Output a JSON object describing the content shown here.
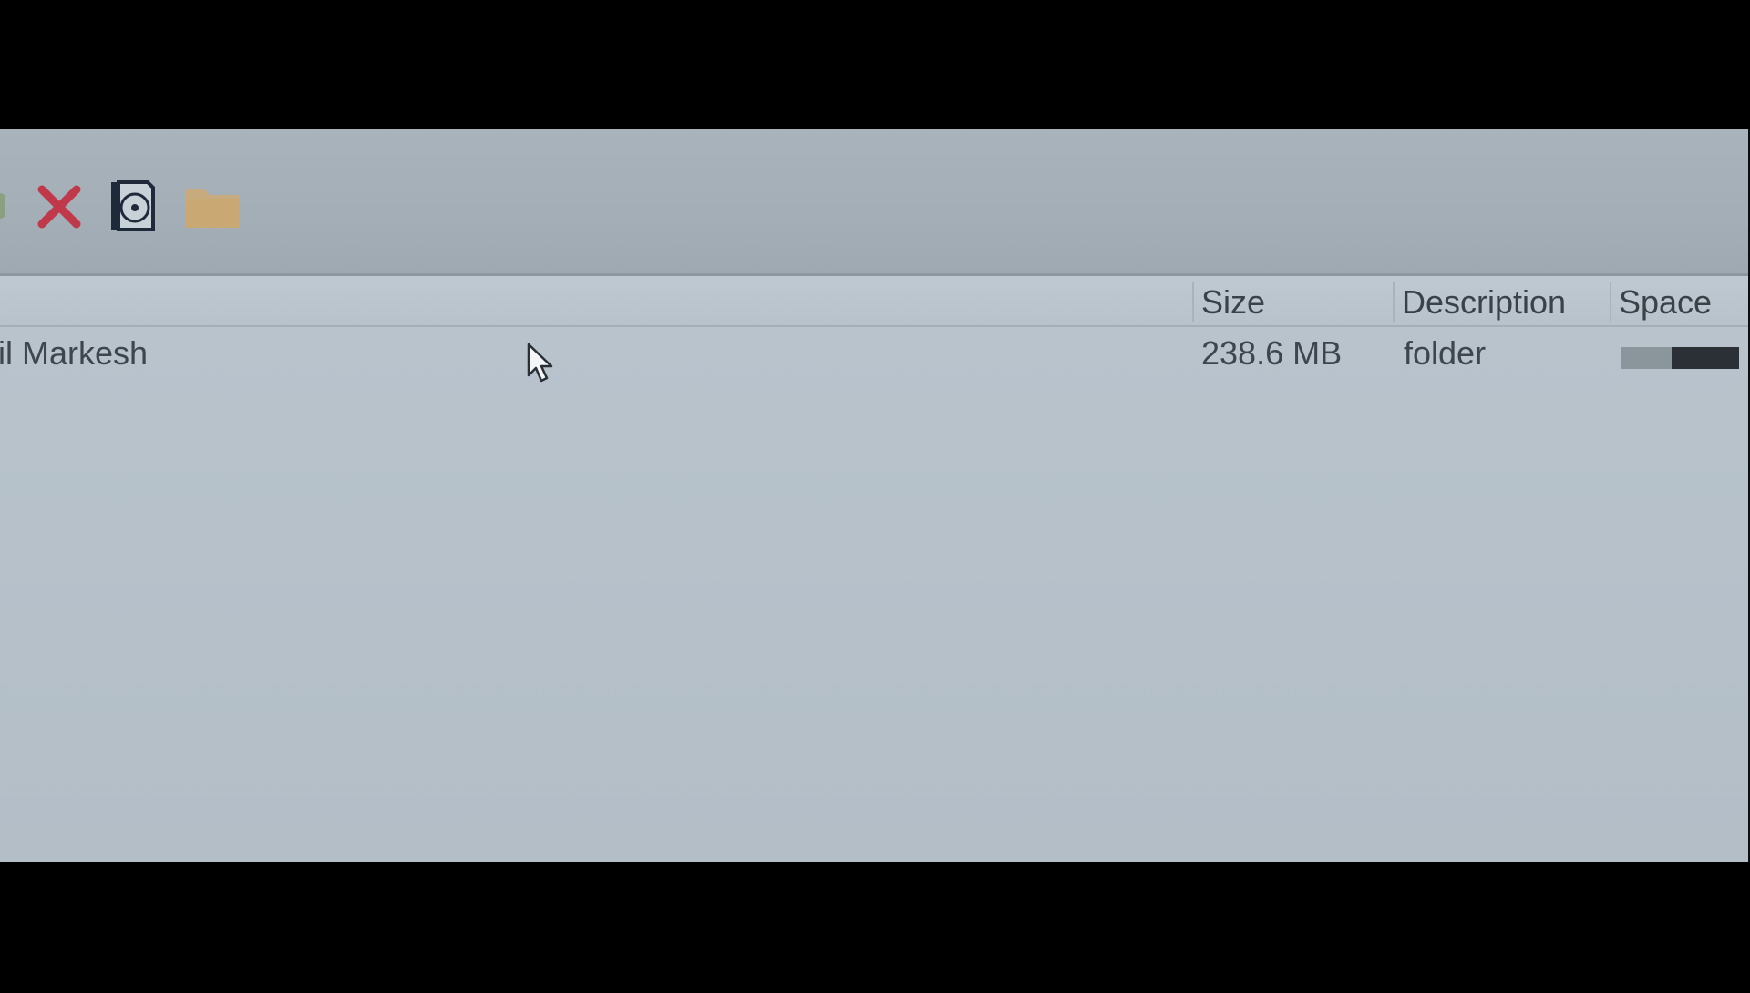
{
  "toolbar": {
    "buttons": [
      {
        "name": "partial-button",
        "icon": "green-icon"
      },
      {
        "name": "delete-button",
        "icon": "close-icon",
        "color": "#c0394b"
      },
      {
        "name": "disc-button",
        "icon": "disc-icon"
      },
      {
        "name": "folder-button",
        "icon": "folder-icon",
        "color": "#c9a874"
      }
    ]
  },
  "list": {
    "columns": {
      "size": "Size",
      "description": "Description",
      "space": "Space"
    },
    "rows": [
      {
        "name": "nil Markesh",
        "size": "238.6 MB",
        "description": "folder",
        "space_used_fraction": 0.43
      }
    ]
  }
}
